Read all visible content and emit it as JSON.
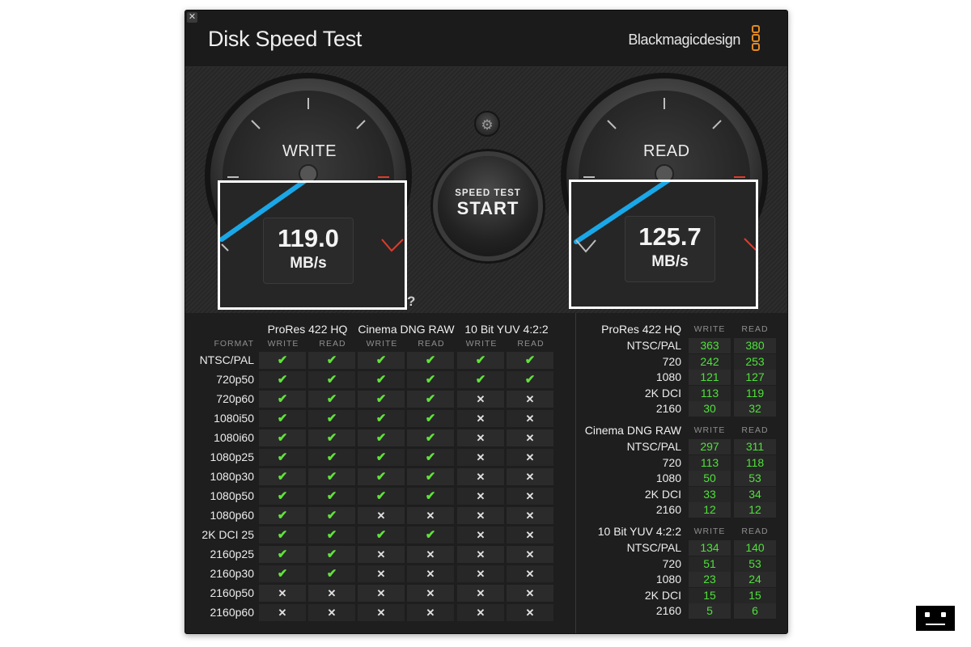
{
  "app": {
    "title": "Disk Speed Test",
    "brand": "Blackmagicdesign",
    "close_glyph": "✕",
    "accent_color": "#e38a1f"
  },
  "gauges": {
    "write": {
      "label": "WRITE",
      "value": "119.0",
      "unit": "MB/s",
      "needle_color": "#1aa7e8"
    },
    "read": {
      "label": "READ",
      "value": "125.7",
      "unit": "MB/s",
      "needle_color": "#1aa7e8"
    }
  },
  "controls": {
    "settings_icon": "gear-icon",
    "settings_glyph": "⚙",
    "start_small": "SPEED TEST",
    "start_big": "START",
    "help_glyph": "?"
  },
  "compat": {
    "format_header": "FORMAT",
    "groups": [
      "ProRes 422 HQ",
      "Cinema DNG RAW",
      "10 Bit YUV 4:2:2"
    ],
    "sub_headers": [
      "WRITE",
      "READ",
      "WRITE",
      "READ",
      "WRITE",
      "READ"
    ],
    "ok_glyph": "✔",
    "no_glyph": "✕",
    "rows": [
      {
        "label": "NTSC/PAL",
        "cells": [
          1,
          1,
          1,
          1,
          1,
          1
        ]
      },
      {
        "label": "720p50",
        "cells": [
          1,
          1,
          1,
          1,
          1,
          1
        ]
      },
      {
        "label": "720p60",
        "cells": [
          1,
          1,
          1,
          1,
          0,
          0
        ]
      },
      {
        "label": "1080i50",
        "cells": [
          1,
          1,
          1,
          1,
          0,
          0
        ]
      },
      {
        "label": "1080i60",
        "cells": [
          1,
          1,
          1,
          1,
          0,
          0
        ]
      },
      {
        "label": "1080p25",
        "cells": [
          1,
          1,
          1,
          1,
          0,
          0
        ]
      },
      {
        "label": "1080p30",
        "cells": [
          1,
          1,
          1,
          1,
          0,
          0
        ]
      },
      {
        "label": "1080p50",
        "cells": [
          1,
          1,
          1,
          1,
          0,
          0
        ]
      },
      {
        "label": "1080p60",
        "cells": [
          1,
          1,
          0,
          0,
          0,
          0
        ]
      },
      {
        "label": "2K DCI 25",
        "cells": [
          1,
          1,
          1,
          1,
          0,
          0
        ]
      },
      {
        "label": "2160p25",
        "cells": [
          1,
          1,
          0,
          0,
          0,
          0
        ]
      },
      {
        "label": "2160p30",
        "cells": [
          1,
          1,
          0,
          0,
          0,
          0
        ]
      },
      {
        "label": "2160p50",
        "cells": [
          0,
          0,
          0,
          0,
          0,
          0
        ]
      },
      {
        "label": "2160p60",
        "cells": [
          0,
          0,
          0,
          0,
          0,
          0
        ]
      }
    ]
  },
  "results": {
    "sub_headers": [
      "WRITE",
      "READ"
    ],
    "groups": [
      {
        "title": "ProRes 422 HQ",
        "rows": [
          {
            "label": "NTSC/PAL",
            "write": "363",
            "read": "380"
          },
          {
            "label": "720",
            "write": "242",
            "read": "253"
          },
          {
            "label": "1080",
            "write": "121",
            "read": "127"
          },
          {
            "label": "2K DCI",
            "write": "113",
            "read": "119"
          },
          {
            "label": "2160",
            "write": "30",
            "read": "32"
          }
        ]
      },
      {
        "title": "Cinema DNG RAW",
        "rows": [
          {
            "label": "NTSC/PAL",
            "write": "297",
            "read": "311"
          },
          {
            "label": "720",
            "write": "113",
            "read": "118"
          },
          {
            "label": "1080",
            "write": "50",
            "read": "53"
          },
          {
            "label": "2K DCI",
            "write": "33",
            "read": "34"
          },
          {
            "label": "2160",
            "write": "12",
            "read": "12"
          }
        ]
      },
      {
        "title": "10 Bit YUV 4:2:2",
        "rows": [
          {
            "label": "NTSC/PAL",
            "write": "134",
            "read": "140"
          },
          {
            "label": "720",
            "write": "51",
            "read": "53"
          },
          {
            "label": "1080",
            "write": "23",
            "read": "24"
          },
          {
            "label": "2K DCI",
            "write": "15",
            "read": "15"
          },
          {
            "label": "2160",
            "write": "5",
            "read": "6"
          }
        ]
      }
    ]
  },
  "tray_icon": "robot-face-icon"
}
